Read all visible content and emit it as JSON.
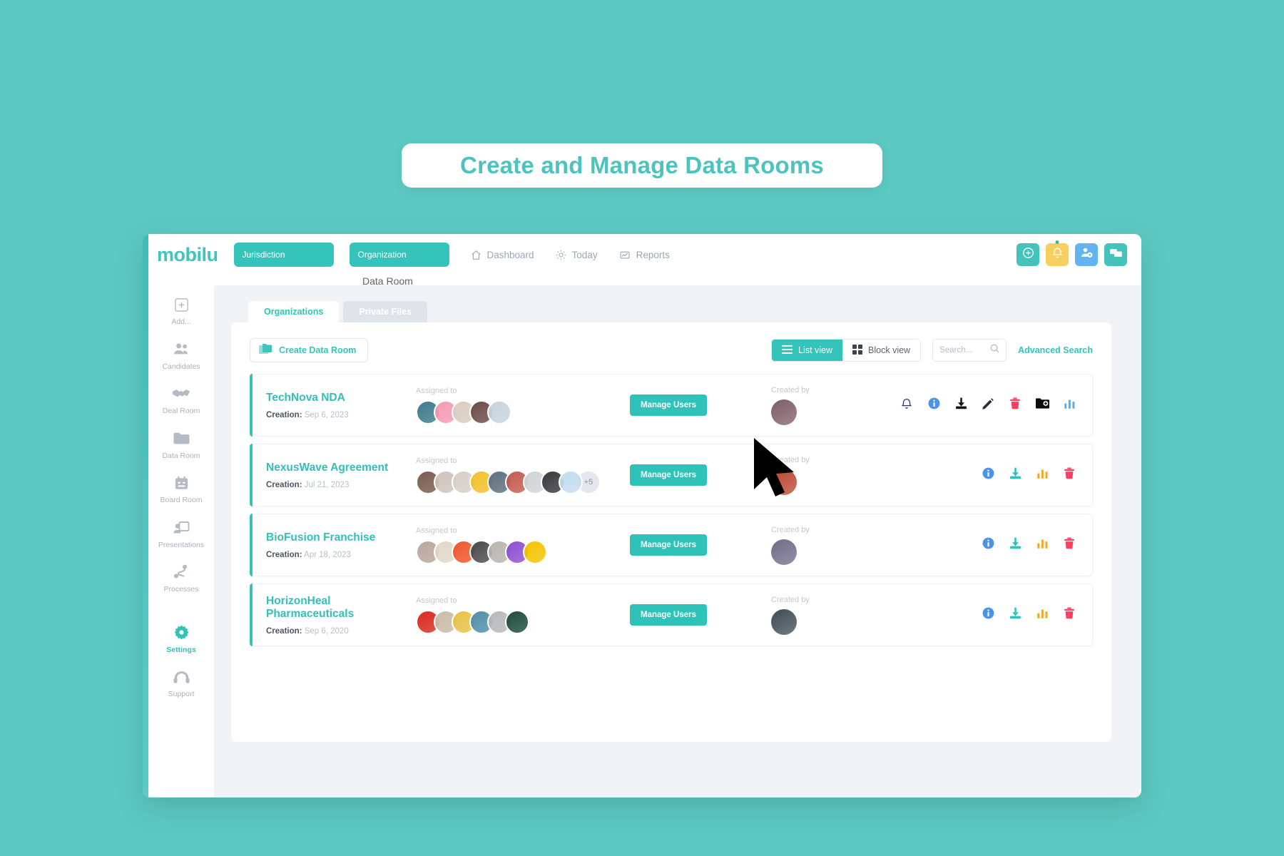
{
  "hero": {
    "title": "Create and Manage Data Rooms"
  },
  "brand": {
    "name": "mobilu",
    "accent": "#35c4bb",
    "yellow": "#f7cf5c",
    "blue": "#63b3ef"
  },
  "topbar": {
    "pills": [
      {
        "label": "Jurisdiction",
        "name": "jurisdiction-selector"
      },
      {
        "label": "Organization",
        "name": "organization-selector"
      }
    ],
    "nav": [
      {
        "label": "Dashboard",
        "icon": "home-icon"
      },
      {
        "label": "Today",
        "icon": "sun-icon"
      },
      {
        "label": "Reports",
        "icon": "report-icon"
      }
    ],
    "actions": [
      {
        "icon": "plus-circle-icon",
        "color": "teal"
      },
      {
        "icon": "bell-icon",
        "color": "yellow",
        "badge": true
      },
      {
        "icon": "user-settings-icon",
        "color": "blue"
      },
      {
        "icon": "chat-icon",
        "color": "teal"
      }
    ]
  },
  "breadcrumb": "Data Room",
  "sidebar": {
    "items": [
      {
        "label": "Add...",
        "icon": "plus-square-icon",
        "active": false
      },
      {
        "label": "Candidates",
        "icon": "people-icon",
        "active": false
      },
      {
        "label": "Deal Room",
        "icon": "handshake-icon",
        "active": false
      },
      {
        "label": "Data Room",
        "icon": "folder-icon",
        "active": false
      },
      {
        "label": "Board Room",
        "icon": "calendar-icon",
        "active": false
      },
      {
        "label": "Presentations",
        "icon": "presentation-icon",
        "active": false
      },
      {
        "label": "Processes",
        "icon": "route-icon",
        "active": false
      },
      {
        "label": "Settings",
        "icon": "gear-icon",
        "active": true
      },
      {
        "label": "Support",
        "icon": "headset-icon",
        "active": false
      }
    ]
  },
  "tabs": [
    {
      "label": "Organizations",
      "active": true
    },
    {
      "label": "Private Files",
      "active": false
    }
  ],
  "toolbar": {
    "create_label": "Create Data Room",
    "list_view_label": "List view",
    "block_view_label": "Block view",
    "search_placeholder": "Search...",
    "advanced_search_label": "Advanced Search"
  },
  "labels": {
    "assigned_to": "Assigned to",
    "created_by": "Created by",
    "creation_prefix": "Creation:",
    "manage_users": "Manage Users"
  },
  "rows": [
    {
      "title": "TechNova NDA",
      "creation": "Sep 6, 2023",
      "assignee_count": 5,
      "overflow": null,
      "avatar_colors": [
        "#3c7b8c",
        "#f49ab4",
        "#d9cdbd",
        "#6b4a49",
        "#c7d3de"
      ],
      "creator_color": "#7d5c64",
      "actions": [
        {
          "icon": "bell-icon",
          "color": "#2b2f6b"
        },
        {
          "icon": "info-icon",
          "color": "#4b93e8"
        },
        {
          "icon": "download-icon",
          "color": "#141414"
        },
        {
          "icon": "edit-icon",
          "color": "#2a2a3a"
        },
        {
          "icon": "trash-icon",
          "color": "#fa3f62"
        },
        {
          "icon": "folder-add-icon",
          "color": "#0d0d0d"
        },
        {
          "icon": "chart-icon",
          "color": "#62a9e8"
        }
      ]
    },
    {
      "title": "NexusWave Agreement",
      "creation": "Jul 21, 2023",
      "assignee_count": 9,
      "overflow": "+5",
      "avatar_colors": [
        "#7a5b4d",
        "#cfc3bb",
        "#d7cec6",
        "#f2c029",
        "#5d6f7e",
        "#c45a4e",
        "#cfd4d9",
        "#39393b",
        "#c3dcef"
      ],
      "creator_color": "#b8452e",
      "actions": [
        {
          "icon": "info-icon",
          "color": "#4b93e8"
        },
        {
          "icon": "download-icon",
          "color": "#2fc2b8"
        },
        {
          "icon": "chart-icon",
          "color": "#f3a81f"
        },
        {
          "icon": "trash-icon",
          "color": "#fa3f62"
        }
      ]
    },
    {
      "title": "BioFusion Franchise",
      "creation": "Apr 18, 2023",
      "assignee_count": 7,
      "overflow": null,
      "avatar_colors": [
        "#b9a79a",
        "#e2d7c6",
        "#f0562a",
        "#4a4a4c",
        "#b9b4af",
        "#8e4fd0",
        "#f4c400"
      ],
      "creator_color": "#6e6a86",
      "actions": [
        {
          "icon": "info-icon",
          "color": "#4b93e8"
        },
        {
          "icon": "download-icon",
          "color": "#2fc2b8"
        },
        {
          "icon": "chart-icon",
          "color": "#f3a81f"
        },
        {
          "icon": "trash-icon",
          "color": "#fa3f62"
        }
      ]
    },
    {
      "title": "HorizonHeal Pharmaceuticals",
      "creation": "Sep 6, 2020",
      "assignee_count": 6,
      "overflow": null,
      "avatar_colors": [
        "#d9291d",
        "#cbbba6",
        "#e8c246",
        "#4f8fa8",
        "#b6b8bd",
        "#1e4b3c"
      ],
      "creator_color": "#3f4a52",
      "actions": [
        {
          "icon": "info-icon",
          "color": "#4b93e8"
        },
        {
          "icon": "download-icon",
          "color": "#2fc2b8"
        },
        {
          "icon": "chart-icon",
          "color": "#f3a81f"
        },
        {
          "icon": "trash-icon",
          "color": "#fa3f62"
        }
      ]
    }
  ]
}
